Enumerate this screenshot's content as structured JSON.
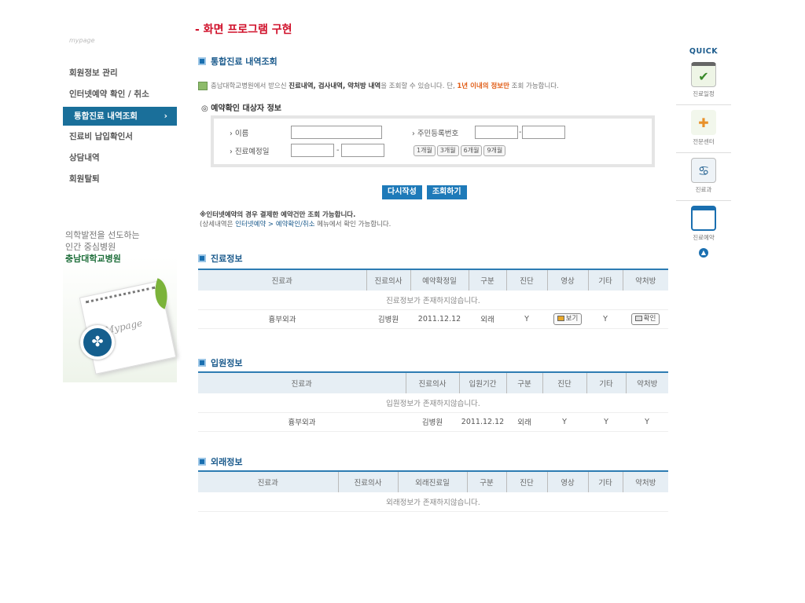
{
  "page_title": "- 화면 프로그램 구현",
  "sidebar": {
    "top_label": "mypage",
    "items": [
      {
        "label": "회원정보 관리"
      },
      {
        "label": "인터넷예약 확인 / 취소"
      },
      {
        "label": "통합진료 내역조회",
        "arrow": "›"
      },
      {
        "label": "진료비 납입확인서"
      },
      {
        "label": "상담내역"
      },
      {
        "label": "회원탈퇴"
      }
    ],
    "slogan": [
      "의학발전을 선도하는",
      "인간 중심병원",
      "충남대학교병원"
    ],
    "calendar_label": "Mypage"
  },
  "main": {
    "section_title": "통합진료 내역조회",
    "info": {
      "p1": "충남대학교병원에서 받으신 ",
      "b1": "진료내역, 검사내역, 약처방 내역",
      "p2": "을 조회할 수 있습니다. 단, ",
      "o1": "1년 이내의 정보만",
      "p3": " 조회 가능합니다."
    },
    "target_title": "◎ 예약확인 대상자 정보",
    "form": {
      "name_label": "› 이름",
      "rrn_label": "› 주민등록번호",
      "date_label": "› 진료예정일",
      "dash": "-",
      "periods": [
        "1개월",
        "3개월",
        "6개월",
        "9개월"
      ]
    },
    "buttons": {
      "reset": "다시작성",
      "search": "조회하기"
    },
    "note": {
      "line1": "※인터넷예약의 경우 결제한 예약건만 조회 가능합니다.",
      "line2_a": "(상세내역은 ",
      "line2_link": "인터넷예약 > 예약확인/취소",
      "line2_b": " 메뉴에서 확인 가능합니다."
    }
  },
  "treatment": {
    "title": "진료정보",
    "headers": [
      "진료과",
      "진료의사",
      "예약확정일",
      "구분",
      "진단",
      "영상",
      "기타",
      "약처방"
    ],
    "empty": "진료정보가 존재하지않습니다.",
    "row": {
      "dept": "흉부외과",
      "doctor": "김병원",
      "date": "2011.12.12",
      "type": "외래",
      "diag": "Y",
      "image_btn": "보기",
      "etc": "Y",
      "rx_btn": "확인"
    }
  },
  "admission": {
    "title": "입원정보",
    "headers": [
      "진료과",
      "진료의사",
      "입원기간",
      "구분",
      "진단",
      "기타",
      "약처방"
    ],
    "empty": "입원정보가 존재하지않습니다.",
    "row": {
      "dept": "흉부외과",
      "doctor": "김병원",
      "date": "2011.12.12",
      "type": "외래",
      "diag": "Y",
      "etc": "Y",
      "rx": "Y"
    }
  },
  "outpatient": {
    "title": "외래정보",
    "headers": [
      "진료과",
      "진료의사",
      "외래진료일",
      "구분",
      "진단",
      "영상",
      "기타",
      "약처방"
    ],
    "empty": "외래정보가 존재하지않습니다."
  },
  "quick": {
    "title": "QUICK",
    "items": [
      {
        "label": "진료일정",
        "icon": "check-icon"
      },
      {
        "label": "전문센터",
        "icon": "medical-cross-icon"
      },
      {
        "label": "진료과",
        "icon": "stethoscope-icon"
      },
      {
        "label": "진료예약",
        "icon": "window-icon"
      }
    ]
  }
}
